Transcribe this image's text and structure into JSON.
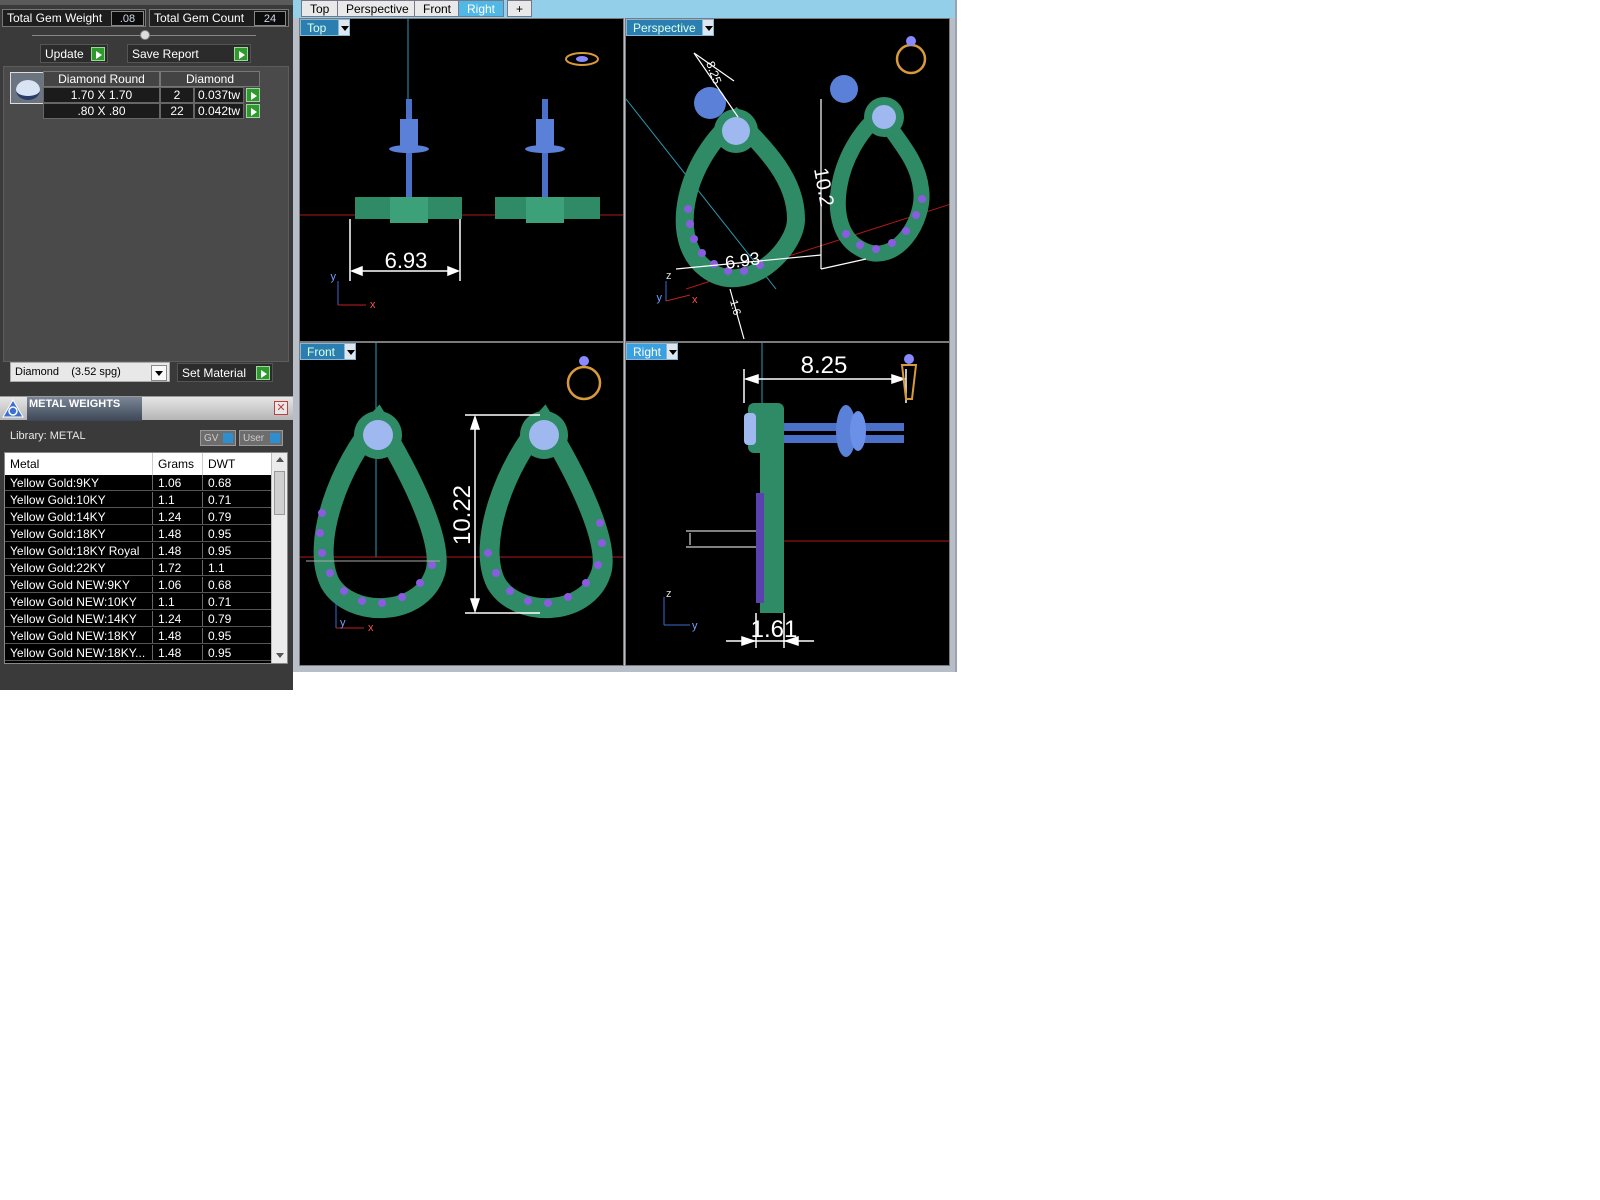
{
  "summary": {
    "total_gem_weight_label": "Total Gem Weight",
    "total_gem_weight_value": ".08",
    "total_gem_count_label": "Total Gem Count",
    "total_gem_count_value": "24"
  },
  "actions": {
    "update_label": "Update",
    "save_report_label": "Save Report"
  },
  "gems": {
    "headers": [
      "Diamond Round",
      "Diamond"
    ],
    "rows": [
      {
        "size": "1.70 X 1.70",
        "count": "2",
        "weight": "0.037tw"
      },
      {
        "size": ".80 X .80",
        "count": "22",
        "weight": "0.042tw"
      }
    ]
  },
  "material": {
    "selected": "Diamond    (3.52 spg)",
    "set_label": "Set Material"
  },
  "metal_weights": {
    "title": "METAL WEIGHTS",
    "library": "Library: METAL",
    "gv_label": "GV",
    "user_label": "User",
    "columns": [
      "Metal",
      "Grams",
      "DWT"
    ],
    "rows": [
      {
        "metal": "Yellow Gold:9KY",
        "grams": "1.06",
        "dwt": "0.68"
      },
      {
        "metal": "Yellow Gold:10KY",
        "grams": "1.1",
        "dwt": "0.71"
      },
      {
        "metal": "Yellow Gold:14KY",
        "grams": "1.24",
        "dwt": "0.79"
      },
      {
        "metal": "Yellow Gold:18KY",
        "grams": "1.48",
        "dwt": "0.95"
      },
      {
        "metal": "Yellow Gold:18KY Royal",
        "grams": "1.48",
        "dwt": "0.95"
      },
      {
        "metal": "Yellow Gold:22KY",
        "grams": "1.72",
        "dwt": "1.1"
      },
      {
        "metal": "Yellow Gold NEW:9KY",
        "grams": "1.06",
        "dwt": "0.68"
      },
      {
        "metal": "Yellow Gold NEW:10KY",
        "grams": "1.1",
        "dwt": "0.71"
      },
      {
        "metal": "Yellow Gold NEW:14KY",
        "grams": "1.24",
        "dwt": "0.79"
      },
      {
        "metal": "Yellow Gold NEW:18KY",
        "grams": "1.48",
        "dwt": "0.95"
      },
      {
        "metal": "Yellow Gold NEW:18KY...",
        "grams": "1.48",
        "dwt": "0.95"
      }
    ]
  },
  "tabs": [
    {
      "label": "Top"
    },
    {
      "label": "Perspective"
    },
    {
      "label": "Front"
    },
    {
      "label": "Right"
    }
  ],
  "tab_add": "+",
  "viewports": {
    "top": {
      "label": "Top",
      "dim": "6.93"
    },
    "perspective": {
      "label": "Perspective",
      "dims": [
        "8.25",
        "10.2",
        "6.93",
        "1.6"
      ]
    },
    "front": {
      "label": "Front",
      "dim": "10.22"
    },
    "right": {
      "label": "Right",
      "dims": [
        "8.25",
        "1.61"
      ]
    }
  },
  "axes": {
    "x": "x",
    "y": "y",
    "z": "z"
  },
  "colors": {
    "metal": "#2f8a66",
    "gem": "#9fb8f0",
    "accent_gem": "#7a3cc8",
    "dimension": "#ffffff",
    "axis_red": "#c02020"
  }
}
